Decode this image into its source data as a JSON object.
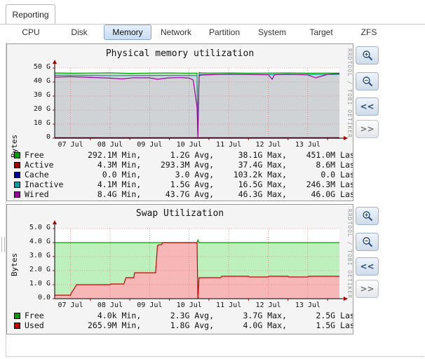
{
  "tabs": {
    "reporting": "Reporting"
  },
  "subtabs": [
    {
      "label": "CPU",
      "active": false
    },
    {
      "label": "Disk",
      "active": false
    },
    {
      "label": "Memory",
      "active": true
    },
    {
      "label": "Network",
      "active": false
    },
    {
      "label": "Partition",
      "active": false
    },
    {
      "label": "System",
      "active": false
    },
    {
      "label": "Target",
      "active": false
    },
    {
      "label": "ZFS",
      "active": false
    }
  ],
  "graphs": [
    {
      "title": "Physical memory utilization",
      "credit": "RRDTOOL / TOBI OETIKER",
      "chart_data": {
        "type": "area",
        "title": "Physical memory utilization",
        "ylabel": "Bytes",
        "yticks": [
          "0",
          "10 G",
          "20 G",
          "30 G",
          "40 G",
          "50 G"
        ],
        "ylim": [
          0,
          50
        ],
        "unit": "G",
        "xticks": [
          "07 Jul",
          "08 Jul",
          "09 Jul",
          "10 Jul",
          "11 Jul",
          "12 Jul",
          "13 Jul"
        ],
        "xlim_days": [
          6.6,
          13.8
        ],
        "series": [
          {
            "name": "Free",
            "color": "#00a000",
            "x": [
              6.6,
              7.0,
              7.5,
              8.0,
              8.5,
              9.0,
              9.5,
              10.0,
              10.2,
              10.22,
              10.25,
              10.3,
              10.5,
              11.0,
              11.5,
              12.0,
              12.5,
              13.0,
              13.5,
              13.8
            ],
            "values": [
              46.5,
              46.3,
              46.4,
              46.6,
              46.2,
              46.4,
              46.5,
              46.3,
              46.4,
              2.0,
              46.8,
              46.6,
              46.4,
              46.5,
              46.3,
              46.4,
              46.5,
              46.3,
              46.4,
              46.4
            ]
          },
          {
            "name": "Active",
            "color": "#a00000",
            "x": [
              6.6,
              13.8
            ],
            "values": [
              0.3,
              0.3
            ]
          },
          {
            "name": "Cache",
            "color": "#0000a0",
            "x": [
              6.6,
              13.8
            ],
            "values": [
              0.0,
              0.0
            ]
          },
          {
            "name": "Inactive",
            "color": "#00a0a0",
            "x": [
              6.6,
              7.0,
              8.0,
              9.0,
              10.0,
              10.2,
              10.22,
              10.25,
              10.3,
              11.0,
              12.0,
              13.0,
              13.8
            ],
            "values": [
              44.8,
              44.8,
              44.6,
              44.7,
              44.7,
              44.6,
              5.0,
              45.5,
              45.4,
              45.4,
              45.3,
              45.4,
              45.5
            ]
          },
          {
            "name": "Wired",
            "color": "#a000a0",
            "x": [
              6.6,
              7.0,
              7.5,
              8.0,
              8.3,
              8.6,
              9.0,
              9.2,
              9.5,
              9.8,
              10.0,
              10.1,
              10.15,
              10.2,
              10.22,
              10.25,
              10.3,
              10.6,
              11.0,
              11.5,
              12.0,
              12.1,
              12.15,
              12.2,
              12.5,
              13.0,
              13.2,
              13.5,
              13.8
            ],
            "values": [
              43.5,
              43.8,
              43.3,
              42.8,
              42.2,
              43.1,
              43.0,
              42.0,
              43.0,
              43.2,
              42.8,
              41.5,
              32.0,
              22.0,
              0.0,
              44.5,
              45.0,
              45.3,
              45.6,
              45.4,
              45.2,
              42.0,
              45.0,
              45.3,
              45.6,
              45.1,
              43.0,
              45.5,
              46.0
            ]
          }
        ]
      },
      "legend": [
        {
          "name": "Free",
          "color": "#00a000",
          "min": "292.1M",
          "avg": "1.2G",
          "max": "38.1G",
          "last": "451.0M"
        },
        {
          "name": "Active",
          "color": "#a00000",
          "min": "4.3M",
          "avg": "293.3M",
          "max": "37.4G",
          "last": "8.6M"
        },
        {
          "name": "Cache",
          "color": "#0000a0",
          "min": "0.0",
          "avg": "3.0",
          "max": "103.2k",
          "last": "0.0"
        },
        {
          "name": "Inactive",
          "color": "#00a0a0",
          "min": "4.1M",
          "avg": "1.5G",
          "max": "16.5G",
          "last": "246.3M"
        },
        {
          "name": "Wired",
          "color": "#a000a0",
          "min": "8.4G",
          "avg": "43.7G",
          "max": "46.3G",
          "last": "46.0G"
        }
      ]
    },
    {
      "title": "Swap Utilization",
      "credit": "RRDTOOL / TOBI OETIKER",
      "chart_data": {
        "type": "area",
        "title": "Swap Utilization",
        "ylabel": "Bytes",
        "yticks": [
          "0.0",
          "1.0 G",
          "2.0 G",
          "3.0 G",
          "4.0 G",
          "5.0 G"
        ],
        "ylim": [
          0,
          5
        ],
        "unit": "G",
        "xticks": [
          "07 Jul",
          "08 Jul",
          "09 Jul",
          "10 Jul",
          "11 Jul",
          "12 Jul",
          "13 Jul"
        ],
        "xlim_days": [
          6.6,
          13.8
        ],
        "series": [
          {
            "name": "Free",
            "color": "#00a000",
            "x": [
              6.6,
              10.2,
              10.22,
              10.25,
              13.8
            ],
            "values": [
              4.0,
              4.0,
              4.2,
              4.0,
              4.0
            ]
          },
          {
            "name": "Used",
            "color": "#cc0000",
            "x": [
              6.6,
              7.0,
              7.02,
              7.1,
              7.15,
              8.0,
              8.02,
              8.35,
              8.4,
              8.6,
              8.62,
              9.0,
              9.15,
              9.2,
              9.25,
              9.3,
              9.33,
              10.0,
              10.2,
              10.22,
              10.25,
              10.5,
              10.8,
              10.82,
              11.5,
              11.52,
              12.0,
              12.02,
              12.5,
              12.52,
              13.0,
              13.02,
              13.8
            ],
            "values": [
              0.25,
              0.25,
              0.4,
              0.75,
              1.0,
              1.0,
              1.05,
              1.05,
              1.5,
              1.5,
              1.85,
              1.85,
              1.85,
              3.8,
              3.85,
              3.85,
              4.0,
              4.0,
              4.0,
              0.0,
              1.5,
              1.5,
              1.5,
              1.6,
              1.6,
              1.55,
              1.55,
              1.6,
              1.6,
              1.55,
              1.55,
              1.6,
              1.6
            ]
          }
        ]
      },
      "legend": [
        {
          "name": "Free",
          "color": "#00a000",
          "min": "4.0k",
          "avg": "2.3G",
          "max": "3.7G",
          "last": "2.5G"
        },
        {
          "name": "Used",
          "color": "#cc0000",
          "min": "265.9M",
          "avg": "1.8G",
          "max": "4.0G",
          "last": "1.5G"
        }
      ]
    }
  ],
  "legend_labels": {
    "min": "Min,",
    "avg": "Avg,",
    "max": "Max,",
    "last": "Last"
  },
  "controls": {
    "zoom_in": "+",
    "zoom_out": "−",
    "back": "<<",
    "forward": ">>"
  }
}
